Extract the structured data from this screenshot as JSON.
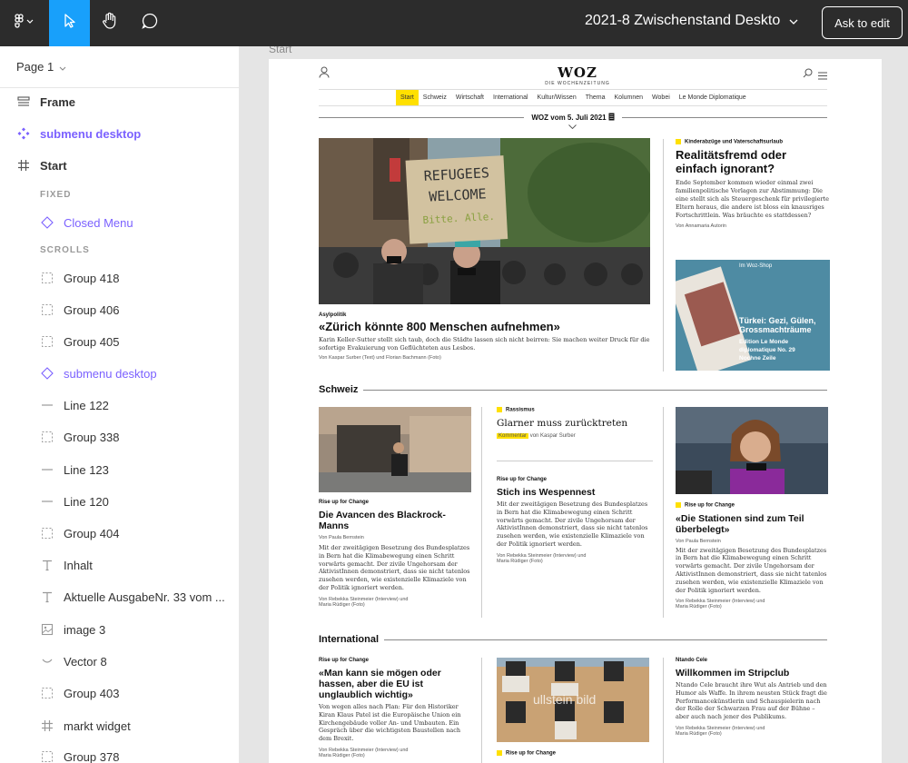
{
  "toolbar": {
    "doc_title": "2021-8 Zwischenstand Deskto",
    "edit_label": "Ask to edit"
  },
  "sidebar": {
    "page_label": "Page 1",
    "layers": [
      {
        "label": "Frame",
        "icon": "frame-lines-icon"
      },
      {
        "label": "submenu desktop",
        "icon": "component-icon"
      },
      {
        "label": "Start",
        "icon": "hash-icon"
      }
    ],
    "section_fixed": "FIXED",
    "fixed_items": [
      {
        "label": "Closed Menu",
        "icon": "instance-icon"
      }
    ],
    "section_scrolls": "SCROLLS",
    "scroll_items": [
      {
        "label": "Group 418",
        "icon": "group-icon"
      },
      {
        "label": "Group 406",
        "icon": "group-icon"
      },
      {
        "label": "Group 405",
        "icon": "group-icon"
      },
      {
        "label": "submenu desktop",
        "icon": "instance-icon"
      },
      {
        "label": "Line 122",
        "icon": "line-icon"
      },
      {
        "label": "Group 338",
        "icon": "group-icon"
      },
      {
        "label": "Line 123",
        "icon": "line-icon"
      },
      {
        "label": "Line 120",
        "icon": "line-icon"
      },
      {
        "label": "Group 404",
        "icon": "group-icon"
      },
      {
        "label": "Inhalt",
        "icon": "text-icon"
      },
      {
        "label": "Aktuelle AusgabeNr. 33 vom ...",
        "icon": "text-icon"
      },
      {
        "label": "image 3",
        "icon": "image-icon"
      },
      {
        "label": "Vector 8",
        "icon": "vector-icon"
      },
      {
        "label": "Group 403",
        "icon": "group-icon"
      },
      {
        "label": "markt widget",
        "icon": "hash-icon"
      },
      {
        "label": "Group 378",
        "icon": "group-icon"
      }
    ]
  },
  "canvas": {
    "frame_label": "Start"
  },
  "woz": {
    "logo": "WOZ",
    "logo_sub": "DIE WOCHENZEITUNG",
    "nav": [
      "Start",
      "Schweiz",
      "Wirtschaft",
      "International",
      "Kultur/Wissen",
      "Thema",
      "Kolumnen",
      "Wobei",
      "Le Monde Diplomatique"
    ],
    "issue": "WOZ vom 5. Juli 2021",
    "hero": {
      "sign_line1": "REFUGEES",
      "sign_line2": "WELCOME",
      "sign_line3": "Bitte. Alle.",
      "kicker": "Asylpolitik",
      "title": "«Zürich könnte 800 Menschen aufnehmen»",
      "body": "Karin Keller-Sutter stellt sich taub, doch die Städte lassen sich nicht beirren: Sie machen weiter Druck für die sofortige Evakuierung von Geflüchteten aus Lesbos.",
      "byline": "Von Kaspar Surber (Text) und Florian Bachmann (Foto)"
    },
    "side1": {
      "kicker": "Kinderabzüge und Vaterschaftsurlaub",
      "title": "Realitätsfremd oder einfach ignorant?",
      "body": "Ende September kommen wieder einmal zwei familienpolitische Vorlagen zur Abstimmung: Die eine stellt sich als Steuergeschenk für privilegierte Eltern heraus, die andere ist bloss ein knausriges Fortschrittlein. Was bräuchte es stattdessen?",
      "byline": "Von Annamaria Autorin"
    },
    "shop": {
      "label": "Im Woz-Shop",
      "title": "Türkei: Gezi, Gülen, Grossmachträume",
      "sub1": "Edition Le Monde",
      "sub2": "diplomatique No. 29",
      "sub3": "Nochne Zeile"
    },
    "schweiz": {
      "head": "Schweiz",
      "a1": {
        "kicker": "Rise up for Change",
        "title": "Die Avancen des Blackrock-Manns",
        "byline": "Von Paula Bernstein",
        "body": "Mit der zweitägigen Besetzung des Bundesplatzes in Bern hat die Klimabewegung einen Schritt vorwärts gemacht. Der zivile Ungehorsam der AktivistInnen demonstriert, dass sie nicht tatenlos zusehen werden, wie existenzielle Klimaziele von der Politik ignoriert werden.",
        "byline2": "Von Rebekka Steinmeier (Interview) und",
        "byline3": "Maria Rüdiger (Foto)"
      },
      "a2": {
        "kicker": "Rassismus",
        "title": "Glarner muss zurücktreten",
        "tag": "Kommentar",
        "byline": "von Kaspar Surber"
      },
      "a3": {
        "kicker": "Rise up for Change",
        "title": "Stich ins Wespennest",
        "body": "Mit der zweitägigen Besetzung des Bundesplatzes in Bern hat die Klimabewegung einen Schritt vorwärts gemacht. Der zivile Ungehorsam der AktivistInnen demonstriert, dass sie nicht tatenlos zusehen werden, wie existenzielle Klimaziele von der Politik ignoriert werden.",
        "byline2": "Von Rebekka Steinmeier (Interview) und",
        "byline3": "Maria Rüdiger (Foto)"
      },
      "a4": {
        "kicker": "Rise up for Change",
        "title": "«Die Stationen sind zum Teil überbelegt»",
        "byline": "Von Paula Bernstein",
        "body": "Mit der zweitägigen Besetzung des Bundesplatzes in Bern hat die Klimabewegung einen Schritt vorwärts gemacht. Der zivile Ungehorsam der AktivistInnen demonstriert, dass sie nicht tatenlos zusehen werden, wie existenzielle Klimaziele von der Politik ignoriert werden.",
        "byline2": "Von Rebekka Steinmeier (Interview) und",
        "byline3": "Maria Rüdiger (Foto)"
      }
    },
    "international": {
      "head": "International",
      "b1": {
        "kicker": "Rise up for Change",
        "title": "«Man kann sie mögen oder hassen, aber die EU ist unglaublich wichtig»",
        "body": "Von wegen alles nach Plan: Für den Historiker Kiran Klaus Patel ist die Europäische Union ein Kirchengebäude voller An- und Umbauten. Ein Gespräch über die wichtigsten Baustellen nach dem Brexit.",
        "byline2": "Von Rebekka Steinmeier (Interview) und",
        "byline3": "Maria Rüdiger (Foto)"
      },
      "b2": {
        "watermark": "ullstein bild",
        "kicker": "Rise up for Change"
      },
      "b3": {
        "kicker": "Ntando Cele",
        "title": "Willkommen im Stripclub",
        "body": "Ntando Cele braucht ihre Wut als Antrieb und den Humor als Waffe. In ihrem neusten Stück fragt die Performancekünstlerin und Schauspielerin nach der Rolle der Schwarzen Frau auf der Bühne – aber auch nach jener des Publikums.",
        "byline2": "Von Rebekka Steinmeier (Interview) und",
        "byline3": "Maria Rüdiger (Foto)"
      }
    }
  }
}
